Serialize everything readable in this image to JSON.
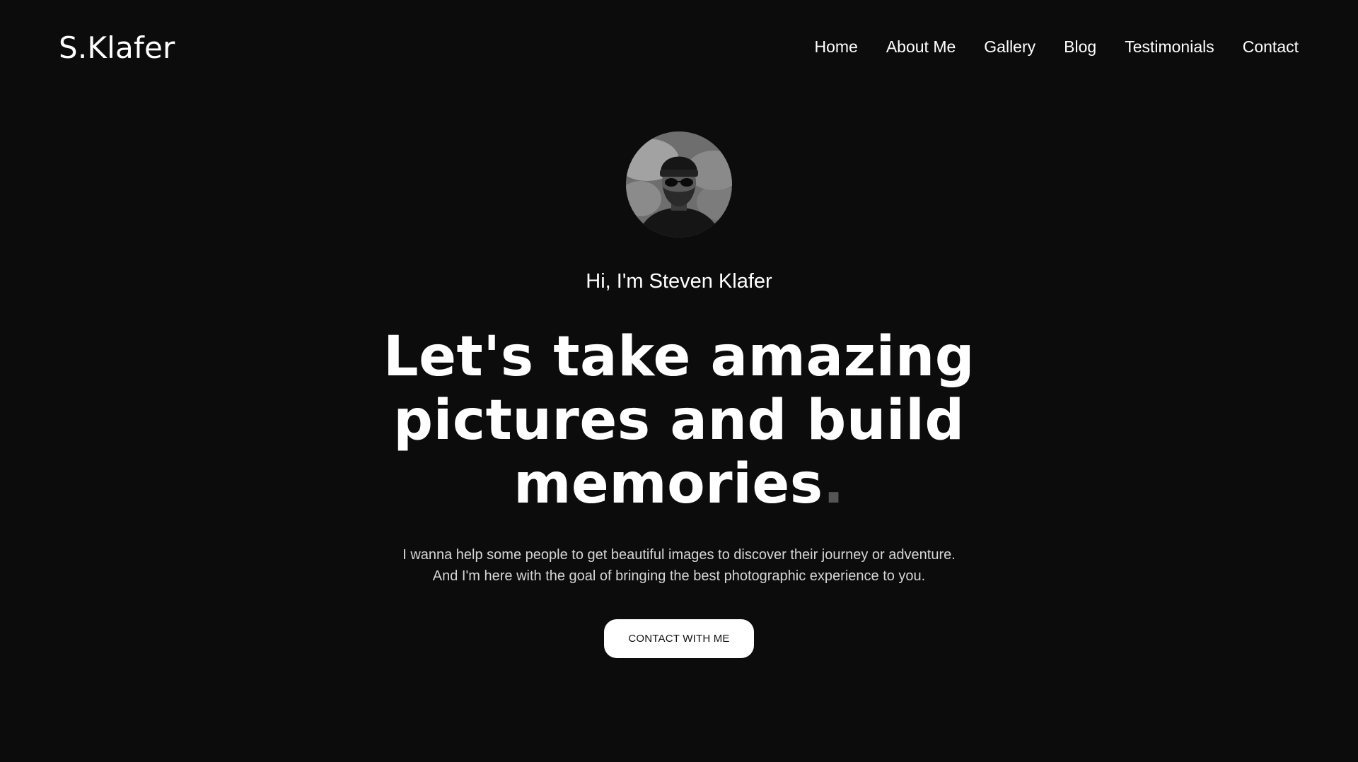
{
  "header": {
    "logo": "S.Klafer",
    "nav": [
      {
        "label": "Home"
      },
      {
        "label": "About Me"
      },
      {
        "label": "Gallery"
      },
      {
        "label": "Blog"
      },
      {
        "label": "Testimonials"
      },
      {
        "label": "Contact"
      }
    ]
  },
  "hero": {
    "greeting": "Hi, I'm Steven Klafer",
    "headline": {
      "text": "Let's take amazing pictures and build memories",
      "accent_dot": "."
    },
    "description": [
      "I wanna help some people to get beautiful images to discover their journey or adventure.",
      "And I'm here with the goal of bringing the best photographic experience to you."
    ],
    "cta_label": "CONTACT WITH ME"
  },
  "colors": {
    "background": "#0c0c0c",
    "text": "#ffffff",
    "muted_text": "#d6d6d6",
    "accent_dot": "#555555",
    "button_bg": "#ffffff",
    "button_text": "#111111"
  }
}
